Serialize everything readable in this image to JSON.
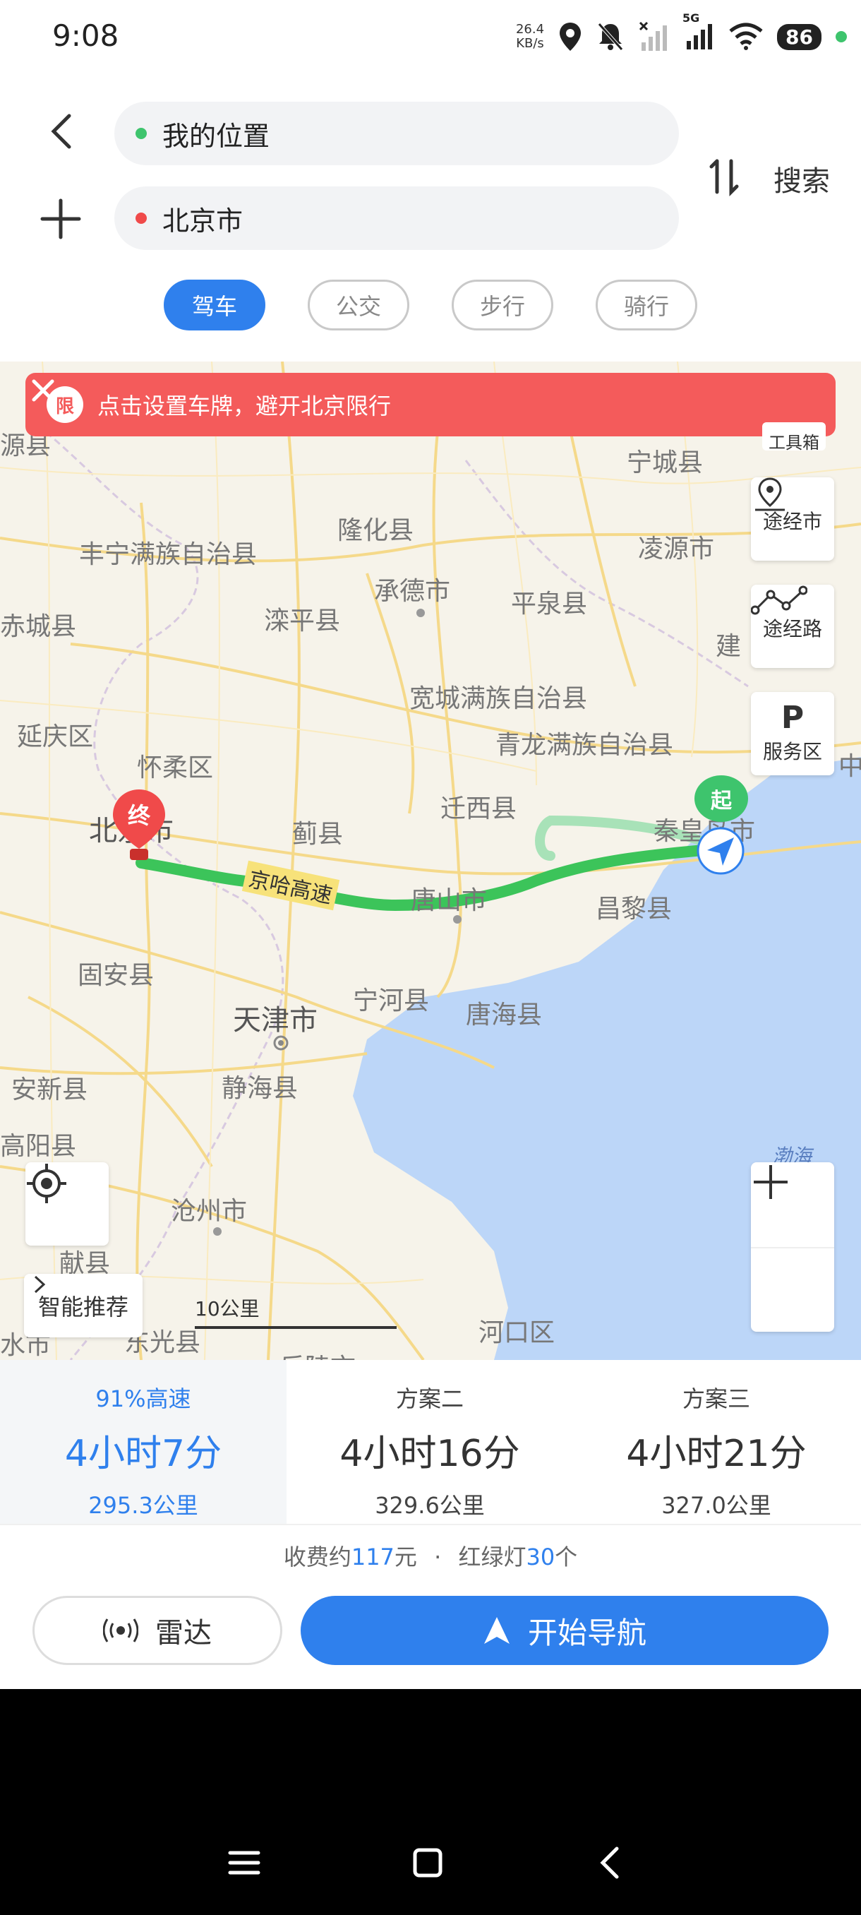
{
  "status_bar": {
    "time": "9:08",
    "speed_value": "26.4",
    "speed_unit": "KB/s",
    "network": "5G",
    "battery": "86"
  },
  "route": {
    "origin": "我的位置",
    "destination": "北京市",
    "search_label": "搜索",
    "origin_color": "#3ec46d",
    "destination_color": "#f04a4a"
  },
  "modes": [
    {
      "label": "驾车",
      "active": true
    },
    {
      "label": "公交",
      "active": false
    },
    {
      "label": "步行",
      "active": false
    },
    {
      "label": "骑行",
      "active": false
    }
  ],
  "map": {
    "banner_badge": "限",
    "banner_text": "点击设置车牌，避开北京限行",
    "tool_label": "工具箱",
    "side_buttons": [
      "途经市",
      "途经路",
      "服务区"
    ],
    "start_marker": "起",
    "end_marker": "终",
    "road_label": "京哈高速",
    "sea_label": "渤海",
    "smart_recommend": "智能推荐",
    "scale": "10公里",
    "places": [
      "源县",
      "宁城县",
      "隆化县",
      "丰宁满族自治县",
      "凌源市",
      "承德市",
      "平泉县",
      "滦平县",
      "赤城县",
      "建",
      "宽城满族自治县",
      "延庆区",
      "青龙满族自治县",
      "怀柔区",
      "迁西县",
      "中",
      "北京市",
      "蓟县",
      "秦皇岛市",
      "唐山市",
      "昌黎县",
      "固安县",
      "宁河县",
      "唐海县",
      "天津市",
      "安新县",
      "静海县",
      "高阳县",
      "沧州市",
      "献县",
      "河口区",
      "东光县",
      "水市",
      "乐陵市"
    ]
  },
  "options": [
    {
      "name": "91%高速",
      "time": "4小时7分",
      "distance": "295.3公里",
      "active": true
    },
    {
      "name": "方案二",
      "time": "4小时16分",
      "distance": "329.6公里",
      "active": false
    },
    {
      "name": "方案三",
      "time": "4小时21分",
      "distance": "327.0公里",
      "active": false
    }
  ],
  "fee": {
    "prefix": "收费约",
    "amount": "117",
    "unit": "元",
    "sep": "·",
    "lights_label": "红绿灯",
    "lights": "30",
    "lights_unit": "个"
  },
  "actions": {
    "radar": "雷达",
    "start_nav": "开始导航"
  },
  "colors": {
    "accent": "#2f80ed",
    "route": "#3cc45a",
    "banner": "#f45b5b",
    "sea": "#bcd6f8"
  }
}
